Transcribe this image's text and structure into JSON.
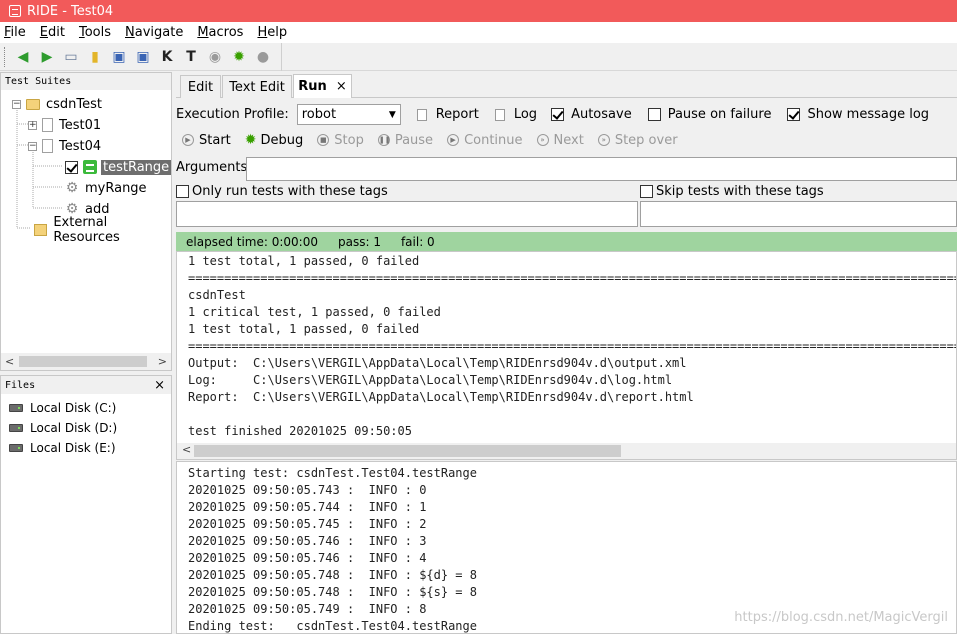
{
  "window": {
    "title": "RIDE - Test04"
  },
  "menu": [
    "File",
    "Edit",
    "Tools",
    "Navigate",
    "Macros",
    "Help"
  ],
  "tree_panel": {
    "title": "Test Suites",
    "nodes": [
      {
        "label": "csdnTest",
        "kind": "folder",
        "expander": "−"
      },
      {
        "label": "Test01",
        "kind": "file",
        "expander": "+"
      },
      {
        "label": "Test04",
        "kind": "file",
        "expander": "−"
      },
      {
        "label": "testRange",
        "kind": "test",
        "selected": true
      },
      {
        "label": "myRange",
        "kind": "keyword"
      },
      {
        "label": "add",
        "kind": "keyword"
      },
      {
        "label": "External Resources",
        "kind": "external"
      }
    ]
  },
  "files_panel": {
    "title": "Files",
    "close": "×",
    "items": [
      "Local Disk (C:)",
      "Local Disk (D:)",
      "Local Disk (E:)"
    ]
  },
  "tabs": [
    {
      "label": "Edit"
    },
    {
      "label": "Text Edit"
    },
    {
      "label": "Run",
      "close": "×"
    }
  ],
  "run": {
    "profile_label": "Execution Profile:",
    "profile_value": "robot",
    "report_label": "Report",
    "log_label": "Log",
    "autosave_label": "Autosave",
    "pause_on_failure_label": "Pause on failure",
    "show_message_log_label": "Show message log",
    "autosave_checked": true,
    "pause_on_failure_checked": false,
    "show_message_log_checked": true,
    "controls": {
      "start": "Start",
      "debug": "Debug",
      "stop": "Stop",
      "pause": "Pause",
      "continue": "Continue",
      "next": "Next",
      "step_over": "Step over"
    },
    "arguments_label": "Arguments:",
    "only_run_tags_label": "Only run tests with these tags",
    "skip_tags_label": "Skip tests with these tags"
  },
  "status": {
    "elapsed": "elapsed time: 0:00:00",
    "pass": "pass: 1",
    "fail": "fail: 0",
    "color": "#9fd49f"
  },
  "output_lines": [
    "1 test total, 1 passed, 0 failed",
    "==============================================================================================================================",
    "csdnTest",
    "1 critical test, 1 passed, 0 failed",
    "1 test total, 1 passed, 0 failed",
    "==============================================================================================================================",
    "Output:  C:\\Users\\VERGIL\\AppData\\Local\\Temp\\RIDEnrsd904v.d\\output.xml",
    "Log:     C:\\Users\\VERGIL\\AppData\\Local\\Temp\\RIDEnrsd904v.d\\log.html",
    "Report:  C:\\Users\\VERGIL\\AppData\\Local\\Temp\\RIDEnrsd904v.d\\report.html",
    "",
    "test finished 20201025 09:50:05"
  ],
  "message_log_lines": [
    "Starting test: csdnTest.Test04.testRange",
    "20201025 09:50:05.743 :  INFO : 0",
    "20201025 09:50:05.744 :  INFO : 1",
    "20201025 09:50:05.745 :  INFO : 2",
    "20201025 09:50:05.746 :  INFO : 3",
    "20201025 09:50:05.746 :  INFO : 4",
    "20201025 09:50:05.748 :  INFO : ${d} = 8",
    "20201025 09:50:05.748 :  INFO : ${s} = 8",
    "20201025 09:50:05.749 :  INFO : 8",
    "Ending test:   csdnTest.Test04.testRange"
  ],
  "watermark": "https://blog.csdn.net/MagicVergil"
}
